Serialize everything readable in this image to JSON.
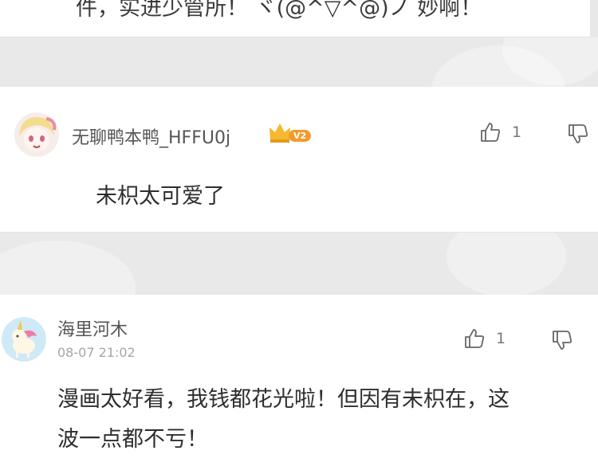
{
  "previous_comment": {
    "tail_text": "件，实进少管所！ ヾ(@^▽^@)ノ 妙啊！"
  },
  "comments": [
    {
      "username": "无聊鸭本鸭_HFFU0j",
      "vip_badge": "V2",
      "likes": "1",
      "text": "未枳太可爱了",
      "avatar_icon": "anime-girl-avatar-icon",
      "accent_color": "#f39a2d"
    },
    {
      "username": "海里河木",
      "timestamp": "08-07 21:02",
      "likes": "1",
      "text_line1": "漫画太好看，我钱都花光啦！但因有未枳在，这",
      "text_line2": "波一点都不亏！",
      "avatar_icon": "unicorn-avatar-icon"
    }
  ]
}
